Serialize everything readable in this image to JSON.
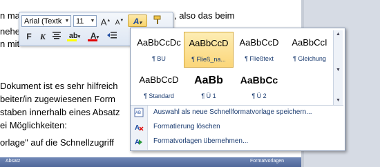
{
  "document": {
    "lines": [
      {
        "text": "n man",
        "left": 0
      },
      {
        "text": "nehen",
        "left": 0
      },
      {
        "text": "n mit",
        "left": 0
      },
      {
        "text": "Dokument ist es sehr hilfreich",
        "left": 0
      },
      {
        "text": "beiter/in zugewiesenen Form",
        "left": 0
      },
      {
        "text": "staben innerhalb eines Absatz",
        "left": 0
      },
      {
        "text": "ei Möglichkeiten:",
        "left": 0
      },
      {
        "text": "orlage\" auf die Schnellzugriff",
        "left": 0
      }
    ],
    "right_fragment": ", also das beim",
    "bottom_left": "Absatz",
    "bottom_right": "Formatvorlagen"
  },
  "mini_toolbar": {
    "font_name": "Arial (Textk",
    "font_size": "11",
    "grow_font": "A",
    "shrink_font": "A",
    "styles_button": "A",
    "bold": "F",
    "italic": "K",
    "highlight": "ab",
    "font_color": "A"
  },
  "gallery": {
    "styles": [
      {
        "preview": "AaBbCcDc",
        "label": "¶ BU",
        "selected": false,
        "bold": false
      },
      {
        "preview": "AaBbCcD",
        "label": "¶ Fließ_na...",
        "selected": true,
        "bold": false
      },
      {
        "preview": "AaBbCcD",
        "label": "¶ Fließtext",
        "selected": false,
        "bold": false
      },
      {
        "preview": "AaBbCcI",
        "label": "¶ Gleichung",
        "selected": false,
        "bold": false
      },
      {
        "preview": "AaBbCcD",
        "label": "¶ Standard",
        "selected": false,
        "bold": false
      },
      {
        "preview": "AaBb",
        "label": "¶ Ü 1",
        "selected": false,
        "bold": true
      },
      {
        "preview": "AaBbCc",
        "label": "¶ Ü 2",
        "selected": false,
        "bold": true
      }
    ],
    "menu": [
      {
        "label": "Auswahl als neue Schnellformatvorlage speichern...",
        "icon": "save-style-icon"
      },
      {
        "label": "Formatierung löschen",
        "icon": "clear-formatting-icon"
      },
      {
        "label": "Formatvorlagen übernehmen...",
        "icon": "apply-styles-icon"
      }
    ]
  },
  "colors": {
    "accent": "#fbd679",
    "menu_text": "#1a3b70",
    "highlight_bar": "#ffff00",
    "font_color_bar": "#e00000"
  }
}
